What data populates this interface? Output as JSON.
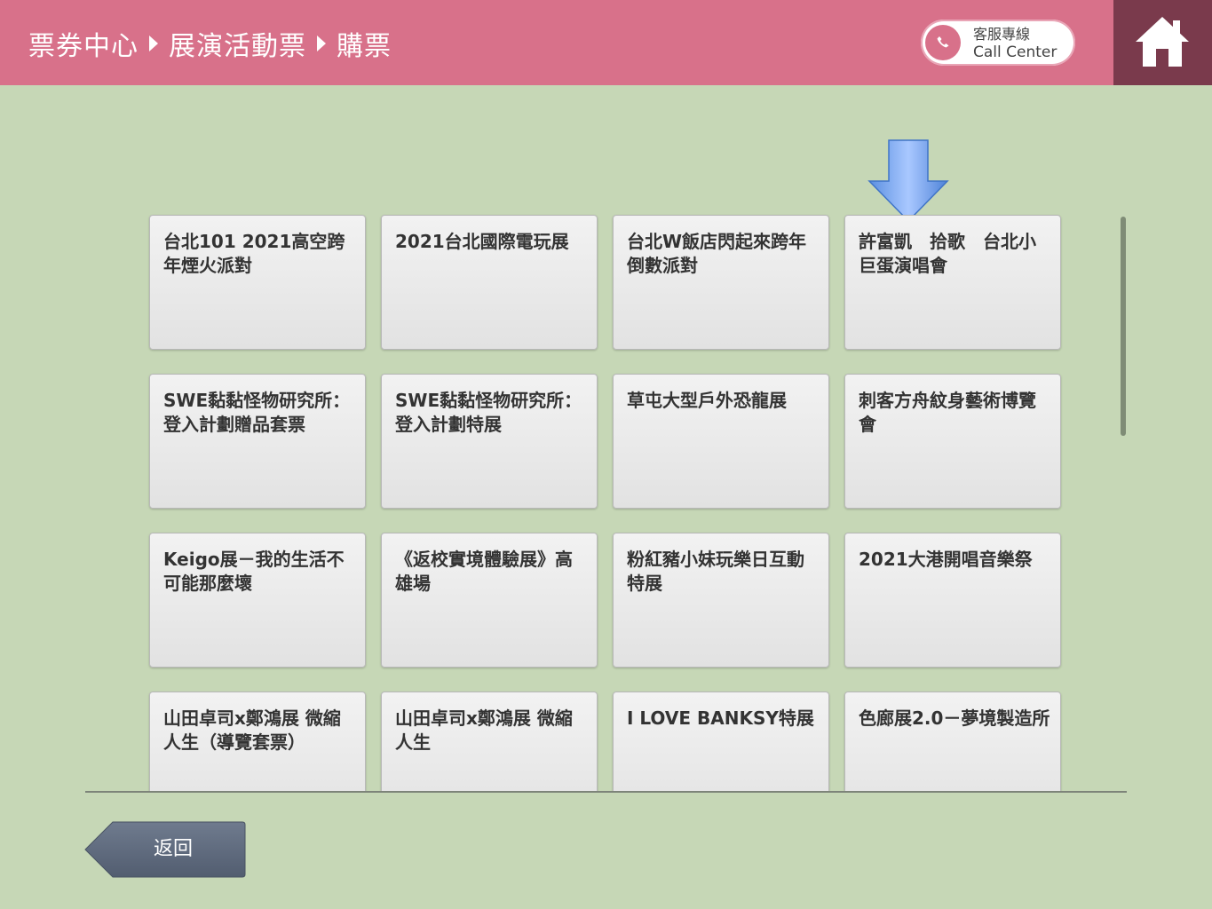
{
  "header": {
    "breadcrumb": [
      "票券中心",
      "展演活動票",
      "購票"
    ],
    "call_center": {
      "label_zh": "客服專線",
      "label_en": "Call Center",
      "icon": "phone-icon"
    },
    "home_icon": "home-icon",
    "colors": {
      "header_bg": "#d8718a",
      "home_bg": "#7a3a4c",
      "page_bg": "#c6d7b6"
    }
  },
  "events": [
    {
      "title": "台北101 2021高空跨年煙火派對"
    },
    {
      "title": "2021台北國際電玩展"
    },
    {
      "title": "台北W飯店閃起來跨年倒數派對"
    },
    {
      "title": "許富凱　拾歌　台北小巨蛋演唱會"
    },
    {
      "title": "SWE黏黏怪物研究所：登入計劃贈品套票"
    },
    {
      "title": "SWE黏黏怪物研究所：登入計劃特展"
    },
    {
      "title": "草屯大型戶外恐龍展"
    },
    {
      "title": "刺客方舟紋身藝術博覽會"
    },
    {
      "title": "Keigo展－我的生活不可能那麼壞"
    },
    {
      "title": "《返校實境體驗展》高雄場"
    },
    {
      "title": "粉紅豬小妹玩樂日互動特展"
    },
    {
      "title": "2021大港開唱音樂祭"
    },
    {
      "title": "山田卓司x鄭鴻展 微縮人生（導覽套票）"
    },
    {
      "title": "山田卓司x鄭鴻展 微縮人生"
    },
    {
      "title": "I LOVE BANKSY特展"
    },
    {
      "title": "色廊展2.0－夢境製造所"
    }
  ],
  "back_button": {
    "label": "返回"
  }
}
